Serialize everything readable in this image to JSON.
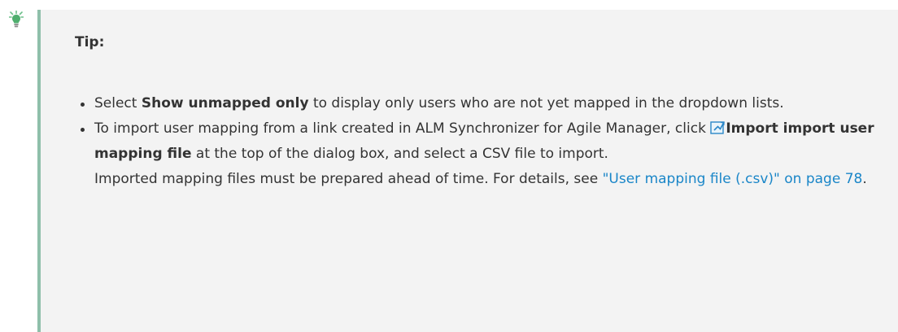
{
  "tip": {
    "heading": "Tip:",
    "icon": "lightbulb-icon",
    "accent_color": "#8fbfaa",
    "background_color": "#f3f3f3",
    "items": [
      {
        "pre": "Select ",
        "bold": "Show unmapped only",
        "post": " to display only users who are not yet mapped in the dropdown lists."
      },
      {
        "pre": "To import user mapping from a link created in ALM Synchronizer for Agile Manager, click ",
        "icon": "import-icon",
        "bold": "Import import user mapping file",
        "post": " at the top of the dialog box, and select a CSV file to import.",
        "note_pre": "Imported mapping files must be prepared ahead of time. For details, see ",
        "link": "\"User mapping file (.csv)\" on page 78",
        "note_post": "."
      }
    ],
    "link_color": "#1a86c8"
  }
}
